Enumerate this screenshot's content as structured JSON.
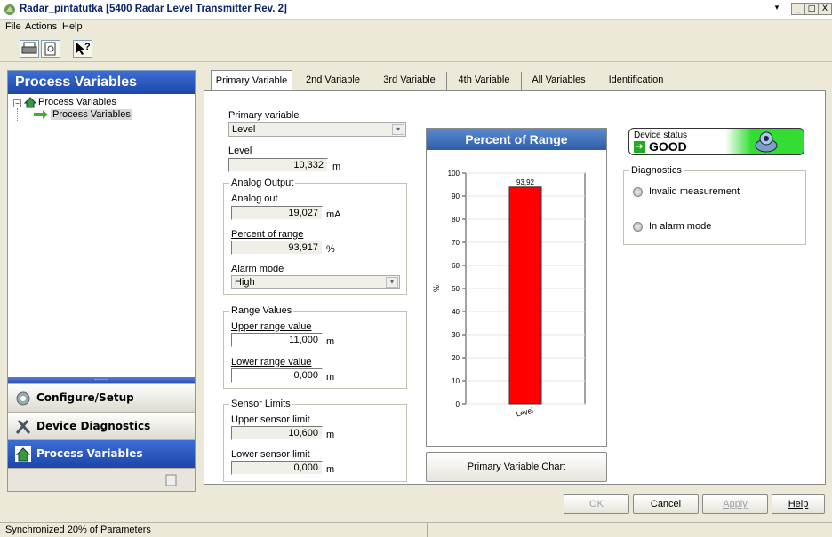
{
  "window": {
    "title": "Radar_pintatutka [5400 Radar Level Transmitter Rev. 2]",
    "controls": {
      "restore": "▾",
      "minimize": "_",
      "maximize": "□",
      "close": "X"
    }
  },
  "menu": [
    "File",
    "Actions",
    "Help"
  ],
  "toolbar": {
    "icons": [
      "print-icon",
      "print-preview-icon",
      "help-pointer-icon"
    ]
  },
  "nav": {
    "header": "Process Variables",
    "tree": {
      "root": "Process Variables",
      "child": "Process Variables"
    },
    "buttons": [
      {
        "label": "Configure/Setup",
        "icon": "gear-icon"
      },
      {
        "label": "Device Diagnostics",
        "icon": "tools-icon"
      },
      {
        "label": "Process Variables",
        "icon": "house-icon"
      }
    ]
  },
  "tabs": [
    "Primary Variable",
    "2nd Variable",
    "3rd Variable",
    "4th Variable",
    "All Variables",
    "Identification"
  ],
  "primary": {
    "pv_label": "Primary variable",
    "pv_value": "Level",
    "level_label": "Level",
    "level_value": "10,332",
    "level_unit": "m"
  },
  "analog": {
    "legend": "Analog Output",
    "out_label": "Analog out",
    "out_value": "19,027",
    "out_unit": "mA",
    "pct_label": "Percent of range",
    "pct_value": "93,917",
    "pct_unit": "%",
    "alarm_label": "Alarm mode",
    "alarm_value": "High"
  },
  "range": {
    "legend": "Range Values",
    "upper_label": "Upper range value",
    "upper_value": "11,000",
    "upper_unit": "m",
    "lower_label": "Lower range value",
    "lower_value": "0,000",
    "lower_unit": "m"
  },
  "sensor": {
    "legend": "Sensor Limits",
    "upper_label": "Upper sensor limit",
    "upper_value": "10,600",
    "upper_unit": "m",
    "lower_label": "Lower sensor limit",
    "lower_value": "0,000",
    "lower_unit": "m"
  },
  "chart_data": {
    "type": "bar",
    "title": "Percent of Range",
    "categories": [
      "Level"
    ],
    "values": [
      93.92
    ],
    "data_labels": [
      "93,92"
    ],
    "ylabel": "%",
    "ylim": [
      0,
      100
    ],
    "yticks": [
      "0",
      "10",
      "20",
      "30",
      "40",
      "50",
      "60",
      "70",
      "80",
      "90",
      "100"
    ],
    "bar_color": "#ff0000",
    "grid": true
  },
  "chart_button": "Primary Variable Chart",
  "device_status": {
    "label": "Device status",
    "value": "GOOD",
    "color": "#33dd33"
  },
  "diagnostics": {
    "legend": "Diagnostics",
    "items": [
      "Invalid measurement",
      "In alarm mode"
    ]
  },
  "buttons": {
    "ok": "OK",
    "cancel": "Cancel",
    "apply": "Apply",
    "help": "Help"
  },
  "status_text": "Synchronized 20% of Parameters"
}
